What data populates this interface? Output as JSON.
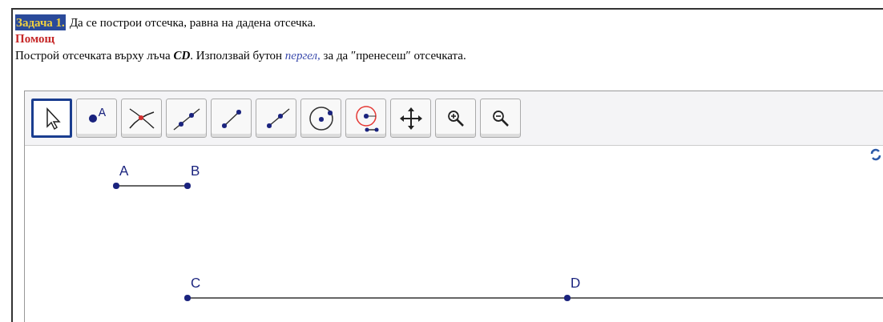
{
  "task": {
    "label": "Задача 1.",
    "text": "Да се построи отсечка, равна на дадена отсечка."
  },
  "help": "Помощ",
  "instruction": [
    {
      "kind": "plain",
      "text": "Построй отсечката върху лъча "
    },
    {
      "kind": "emphasis",
      "text": "CD"
    },
    {
      "kind": "plain",
      "text": ". Използвай бутон "
    },
    {
      "kind": "link",
      "text": "пергел,"
    },
    {
      "kind": "plain",
      "text": " за да ″пренесеш″ отсечката."
    }
  ],
  "applet": {
    "tools": [
      {
        "kind": "move",
        "selected": true
      },
      {
        "kind": "point",
        "selected": false,
        "glyph": "A"
      },
      {
        "kind": "intersect",
        "selected": false
      },
      {
        "kind": "line",
        "selected": false
      },
      {
        "kind": "segment",
        "selected": false
      },
      {
        "kind": "ray",
        "selected": false
      },
      {
        "kind": "circle",
        "selected": false
      },
      {
        "kind": "compass",
        "selected": false
      },
      {
        "kind": "move-view",
        "selected": false
      },
      {
        "kind": "zoom-in",
        "selected": false
      },
      {
        "kind": "zoom-out",
        "selected": false
      }
    ],
    "points": [
      {
        "label": "A"
      },
      {
        "label": "B"
      },
      {
        "label": "C"
      },
      {
        "label": "D"
      }
    ]
  }
}
